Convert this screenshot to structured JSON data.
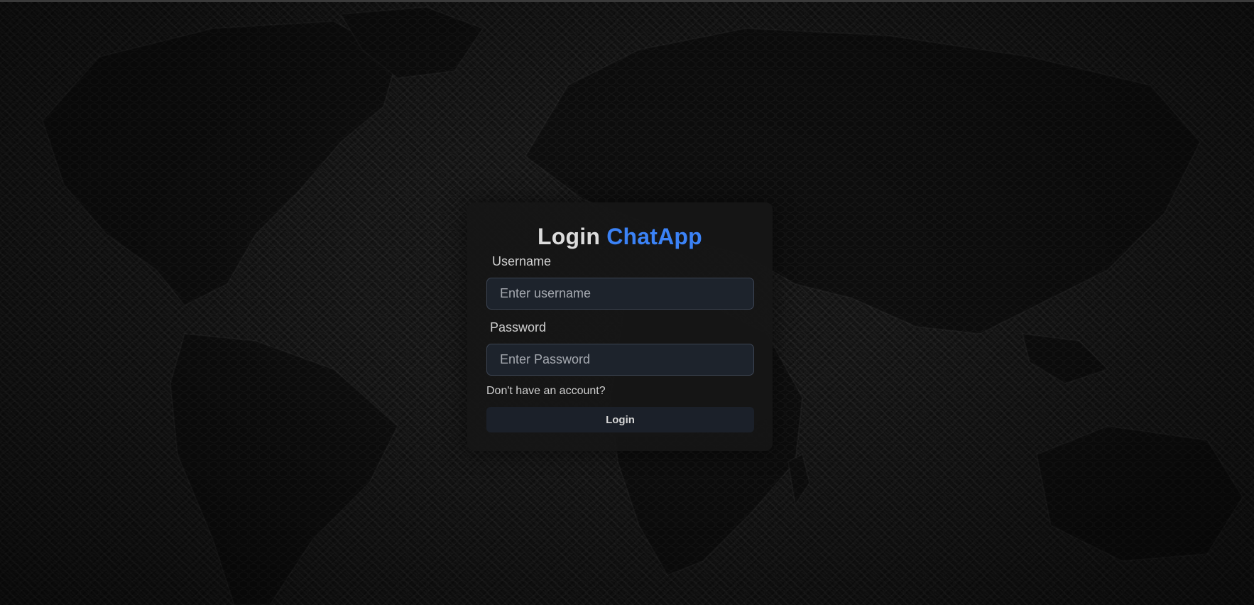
{
  "login": {
    "title_prefix": "Login",
    "title_brand": "ChatApp",
    "username_label": "Username",
    "username_placeholder": "Enter username",
    "username_value": "",
    "password_label": "Password",
    "password_placeholder": "Enter Password",
    "password_value": "",
    "signup_link": "Don't have an account?",
    "submit_label": "Login"
  },
  "theme": {
    "accent": "#3b82f6",
    "background": "#151515",
    "card": "#161616",
    "input_bg": "#1d232c",
    "button_bg": "#1b2029"
  }
}
